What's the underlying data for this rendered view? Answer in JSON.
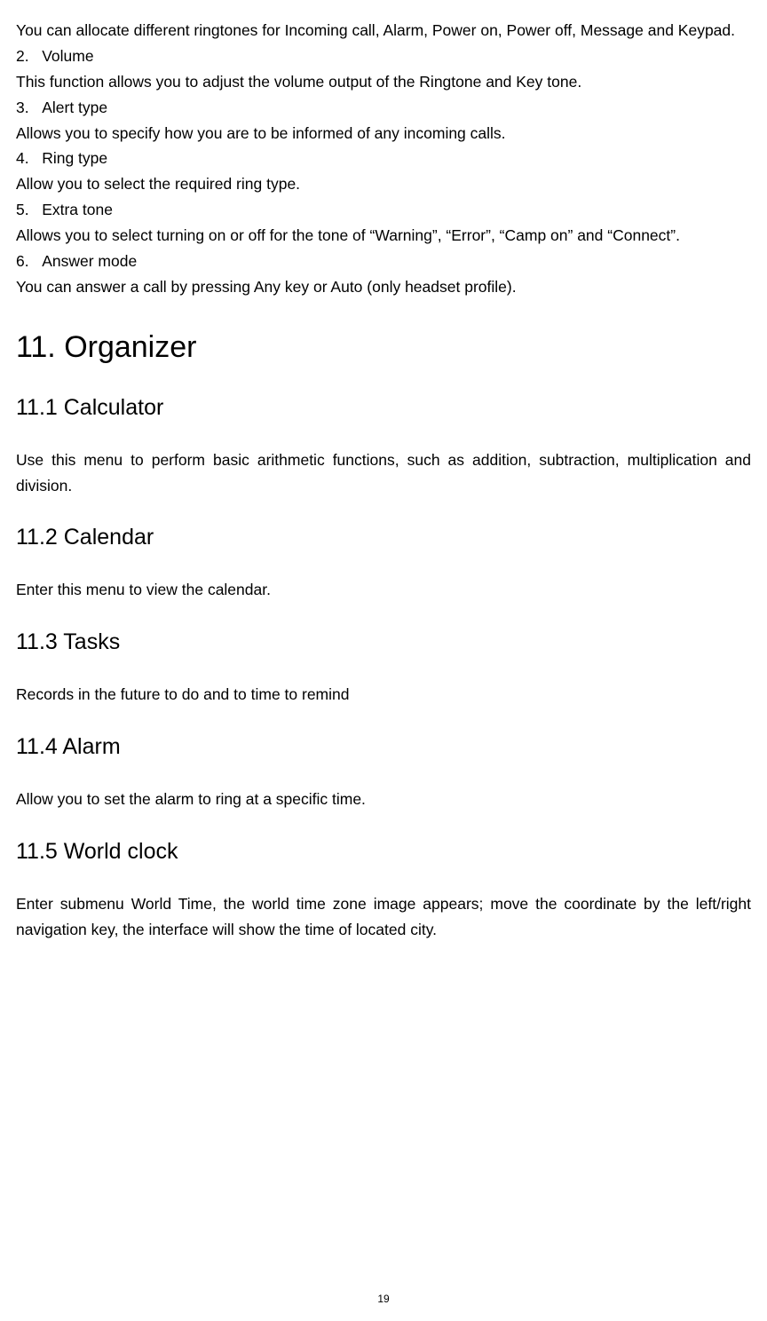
{
  "intro": {
    "p1": "You can allocate different ringtones for Incoming call, Alarm, Power on, Power off, Message and Keypad."
  },
  "items": [
    {
      "num": "2.",
      "title": "Volume",
      "desc": "This function allows you to adjust the volume output of the Ringtone and Key tone."
    },
    {
      "num": "3.",
      "title": "Alert type",
      "desc": "Allows you to specify how you are to be informed of any incoming calls."
    },
    {
      "num": "4.",
      "title": "Ring type",
      "desc": "Allow you to select the required ring type."
    },
    {
      "num": "5.",
      "title": "Extra tone",
      "desc": "Allows you to select turning on or off for the tone of “Warning”, “Error”, “Camp on” and “Connect”."
    },
    {
      "num": "6.",
      "title": "Answer mode",
      "desc": "You can answer a call by pressing Any key or Auto (only headset profile)."
    }
  ],
  "section": {
    "h1": "11. Organizer",
    "subsections": [
      {
        "h2": "11.1 Calculator",
        "desc": "Use this menu to perform basic arithmetic functions, such as addition, subtraction, multiplication and division.",
        "justify": true
      },
      {
        "h2": "11.2 Calendar",
        "desc": "Enter this menu to view the calendar.",
        "justify": false
      },
      {
        "h2": "11.3 Tasks",
        "desc": "Records in the future to do and to time to remind",
        "justify": false
      },
      {
        "h2": "11.4 Alarm",
        "desc": "Allow you to set the alarm to ring at a specific time.",
        "justify": false
      },
      {
        "h2": "11.5 World clock",
        "desc": "Enter submenu World Time, the world time zone image appears; move the coordinate by the left/right navigation key, the interface will show the time of located city.",
        "justify": true
      }
    ]
  },
  "pageNumber": "19"
}
